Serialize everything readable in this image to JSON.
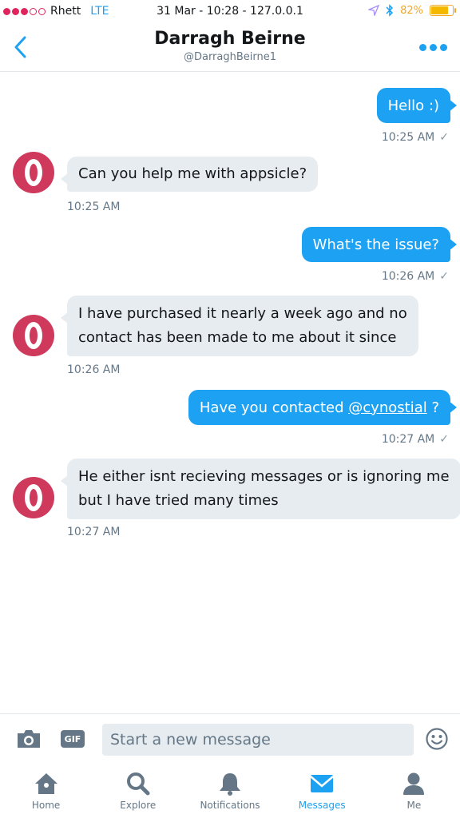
{
  "status_bar": {
    "carrier": "Rhett",
    "network": "LTE",
    "center": "31 Mar - 10:28 - 127.0.0.1",
    "battery_pct": "82%",
    "battery_level": 0.82,
    "signal_filled": 3,
    "signal_total": 5
  },
  "header": {
    "title": "Darragh Beirne",
    "handle": "@DarraghBeirne1"
  },
  "messages": [
    {
      "direction": "sent",
      "text": "Hello :)",
      "time": "10:25 AM"
    },
    {
      "direction": "received",
      "lines": [
        "Can you help me with appsicle?"
      ],
      "time": "10:25 AM"
    },
    {
      "direction": "sent",
      "text": "What's the issue?",
      "time": "10:26 AM"
    },
    {
      "direction": "received",
      "lines": [
        "I have purchased it nearly a week ago and no",
        "contact has been made to me about it since"
      ],
      "time": "10:26 AM"
    },
    {
      "direction": "sent",
      "text_before": "Have you contacted ",
      "mention": "@cynostial",
      "text_after": " ?",
      "time": "10:27 AM"
    },
    {
      "direction": "received",
      "lines": [
        "He either isnt recieving messages or is ignoring me",
        "but I have tried many times"
      ],
      "time": "10:27 AM"
    }
  ],
  "composer": {
    "placeholder": "Start a new message",
    "gif_label": "GIF"
  },
  "tabs": [
    {
      "label": "Home",
      "icon": "home-icon"
    },
    {
      "label": "Explore",
      "icon": "search-icon"
    },
    {
      "label": "Notifications",
      "icon": "bell-icon"
    },
    {
      "label": "Messages",
      "icon": "envelope-icon",
      "active": true
    },
    {
      "label": "Me",
      "icon": "person-icon"
    }
  ],
  "colors": {
    "accent": "#1da1f2",
    "avatar": "#cf3a5c",
    "bubble_received": "#e6ecf0",
    "battery": "#f5a623"
  },
  "check_glyph": "✓"
}
